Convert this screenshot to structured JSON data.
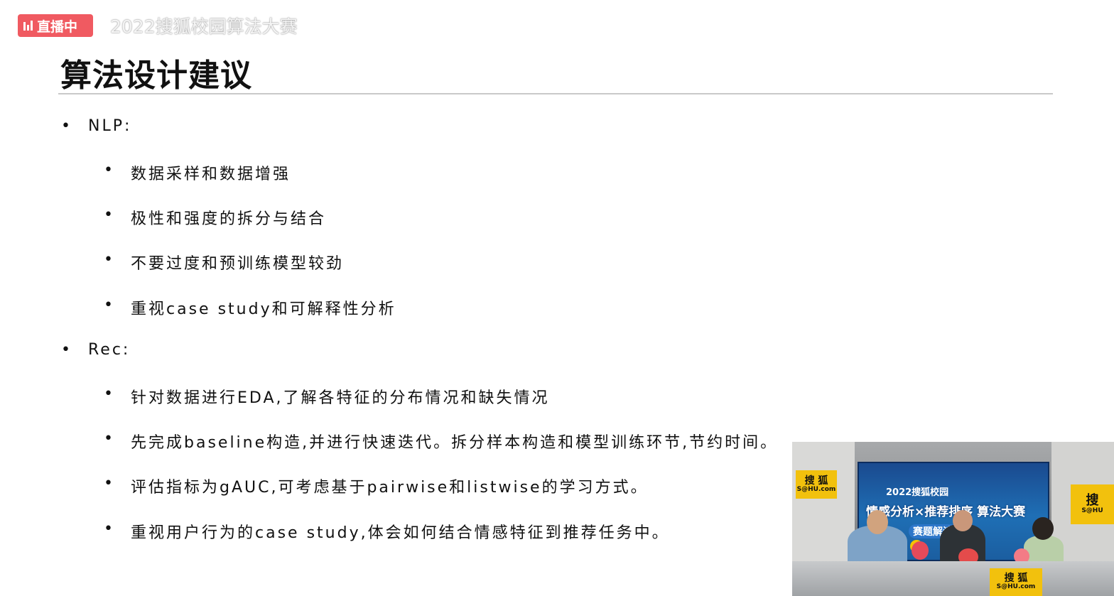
{
  "live": {
    "badge_label": "直播中",
    "event_title": "2022搜狐校园算法大赛"
  },
  "slide": {
    "title": "算法设计建议",
    "bullet_glyph": "•",
    "sections": [
      {
        "label": "NLP:",
        "items": [
          "数据采样和数据增强",
          "极性和强度的拆分与结合",
          "不要过度和预训练模型较劲",
          "重视case study和可解释性分析"
        ]
      },
      {
        "label": "Rec:",
        "items": [
          "针对数据进行EDA,了解各特征的分布情况和缺失情况",
          "先完成baseline构造,并进行快速迭代。拆分样本构造和模型训练环节,节约时间。",
          "评估指标为gAUC,可考虑基于pairwise和listwise的学习方式。",
          "重视用户行为的case study,体会如何结合情感特征到推荐任务中。"
        ]
      }
    ]
  },
  "video": {
    "screen_line1": "2022搜狐校园",
    "screen_line2": "情感分析×推荐排序 算法大赛",
    "screen_line3": "赛题解读直播",
    "sign_left_cn": "搜 狐",
    "sign_left_en": "S@HU.com",
    "sign_right_cn": "搜",
    "sign_right_en": "S@HU",
    "sign_bottom_cn": "搜 狐",
    "sign_bottom_en": "S@HU.com"
  }
}
